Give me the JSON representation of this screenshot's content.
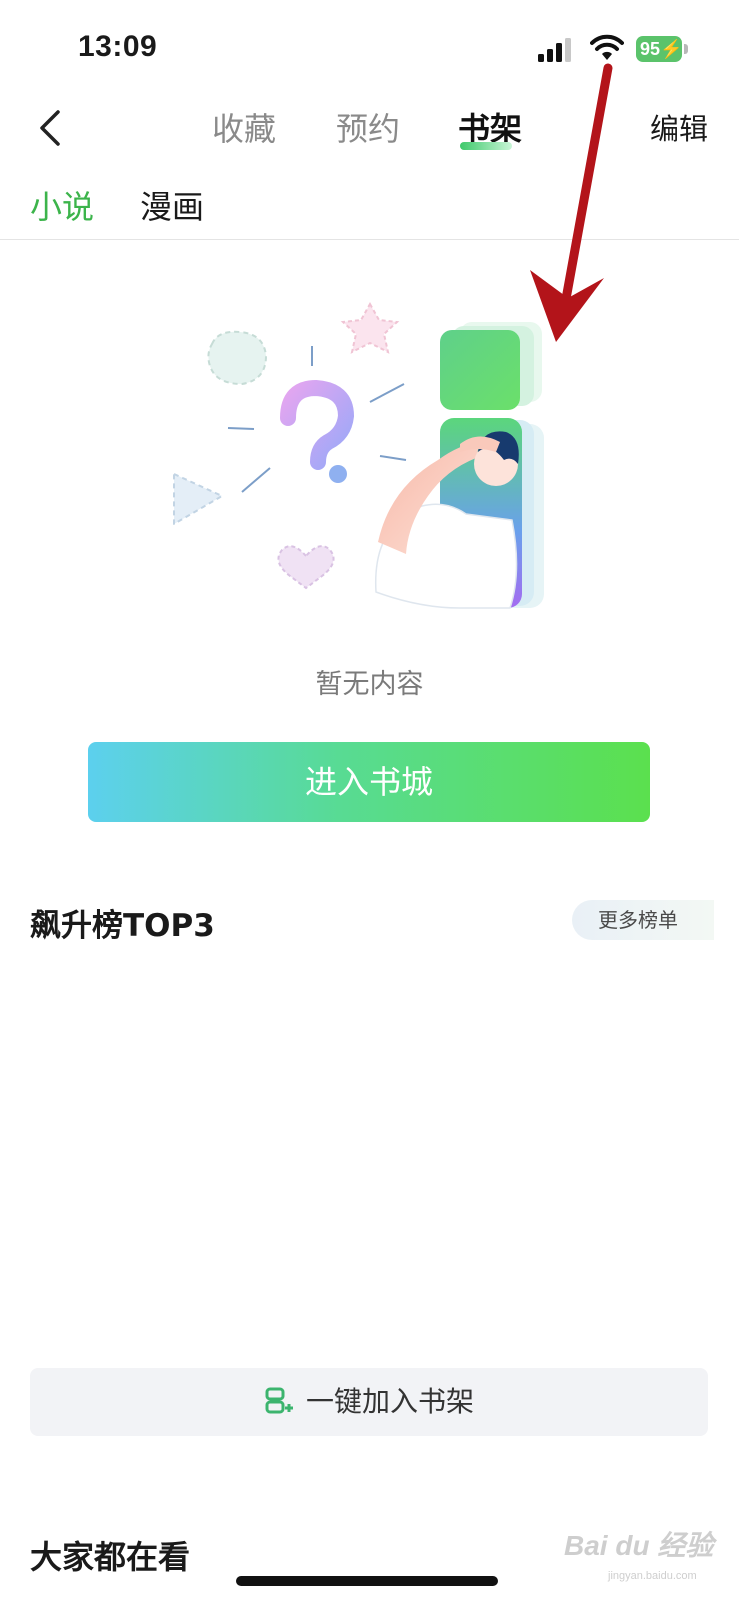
{
  "status_bar": {
    "time": "13:09",
    "battery": "95"
  },
  "nav": {
    "tabs": [
      "收藏",
      "预约",
      "书架"
    ],
    "active_tab": "书架",
    "edit_label": "编辑"
  },
  "sub_tabs": {
    "items": [
      "小说",
      "漫画"
    ],
    "active": "小说"
  },
  "empty_state": {
    "message": "暂无内容"
  },
  "enter_store_label": "进入书城",
  "ranking": {
    "title": "飙升榜TOP3",
    "more_label": "更多榜单"
  },
  "add_to_shelf_label": "一键加入书架",
  "everyone_reading_title": "大家都在看",
  "watermark": {
    "brand": "Bai du 经验",
    "url": "jingyan.baidu.com"
  },
  "colors": {
    "accent_green": "#3cb44b",
    "annotation_arrow": "#b3141a"
  }
}
